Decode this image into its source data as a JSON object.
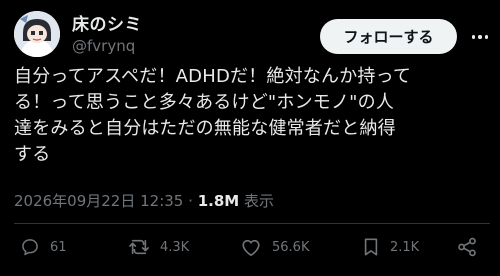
{
  "author": {
    "display_name": "床のシミ",
    "handle": "@fvrynq"
  },
  "follow_button": {
    "label": "フォローする"
  },
  "tweet": {
    "lines": [
      "自分ってアスペだ！ADHDだ！絶対なんか持って",
      "る！って思うこと多々あるけど\"ホンモノ\"の人",
      "達をみると自分はただの無能な健常者だと納得",
      "する"
    ]
  },
  "meta": {
    "timestamp": "2026年09月22日 12:35",
    "separator": "·",
    "views_count": "1.8M",
    "views_label": "表示"
  },
  "actions": {
    "replies": "61",
    "reposts": "4.3K",
    "likes": "56.6K",
    "bookmarks": "2.1K"
  },
  "icons": [
    "avatar",
    "more-icon",
    "reply-icon",
    "repost-icon",
    "like-icon",
    "bookmark-icon",
    "share-icon"
  ],
  "colors": {
    "background": "#000000",
    "text": "#e7e9ea",
    "muted": "#71767b",
    "button": "#eff3f4"
  }
}
